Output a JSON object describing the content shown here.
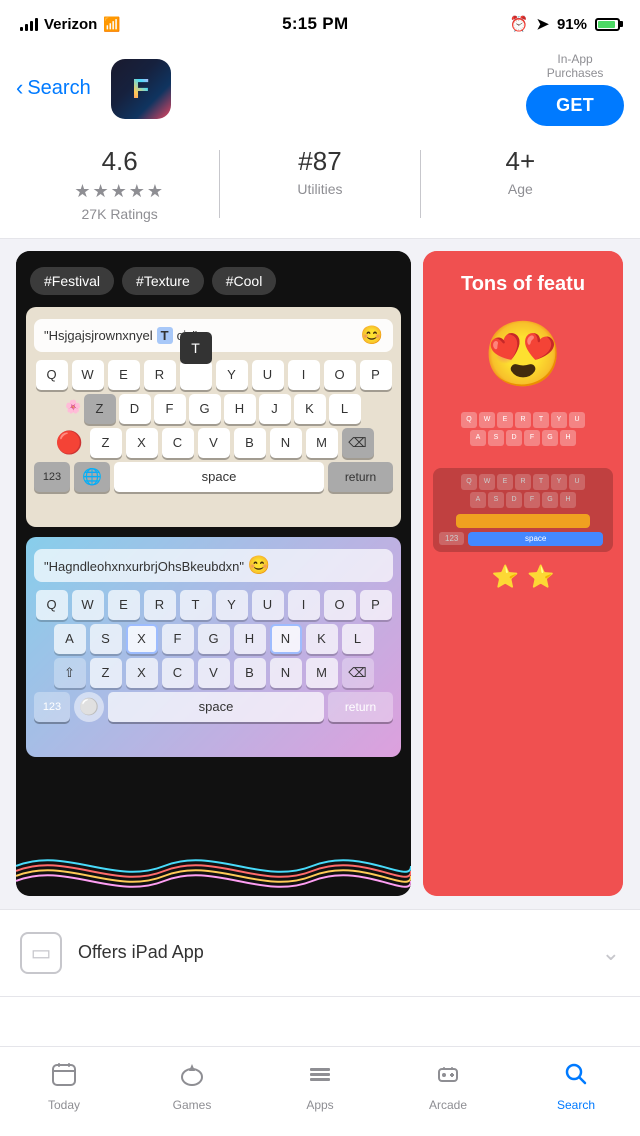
{
  "status": {
    "carrier": "Verizon",
    "time": "5:15 PM",
    "battery_pct": "91%",
    "battery_charging": true
  },
  "header": {
    "back_label": "Search",
    "in_app_label": "In-App\nPurchases",
    "get_label": "GET"
  },
  "ratings": {
    "score": "4.6",
    "stars_label": "★★★★★",
    "ratings_count": "27K Ratings",
    "rank": "#87",
    "category": "Utilities",
    "age": "4+",
    "age_label": "Age"
  },
  "screenshots": {
    "card1_tags": [
      "#Festival",
      "#Texture",
      "#Cool"
    ],
    "card1_text1": "\"Hsjgajsjrownxnyel      ciz\"",
    "card1_text1_highlight": "T",
    "card1_text2": "\"HagndleohxnxurbrjOhsBkeubdxn\"",
    "card2_title": "Tons of featu"
  },
  "ipad_section": {
    "label": "Offers iPad App"
  },
  "tabs": [
    {
      "id": "today",
      "label": "Today",
      "icon": "📱",
      "active": false
    },
    {
      "id": "games",
      "label": "Games",
      "icon": "🚀",
      "active": false
    },
    {
      "id": "apps",
      "label": "Apps",
      "icon": "🗂",
      "active": false
    },
    {
      "id": "arcade",
      "label": "Arcade",
      "icon": "🕹",
      "active": false
    },
    {
      "id": "search",
      "label": "Search",
      "icon": "🔍",
      "active": true
    }
  ],
  "keyboard_rows_qwerty": [
    "Q",
    "W",
    "E",
    "R",
    "T",
    "Y",
    "U",
    "I",
    "O",
    "P"
  ],
  "keyboard_rows_asdf": [
    "A",
    "S",
    "D",
    "F",
    "G",
    "H",
    "J",
    "K",
    "L"
  ],
  "keyboard_rows_zxcv": [
    "Z",
    "X",
    "C",
    "V",
    "B",
    "N",
    "M"
  ]
}
